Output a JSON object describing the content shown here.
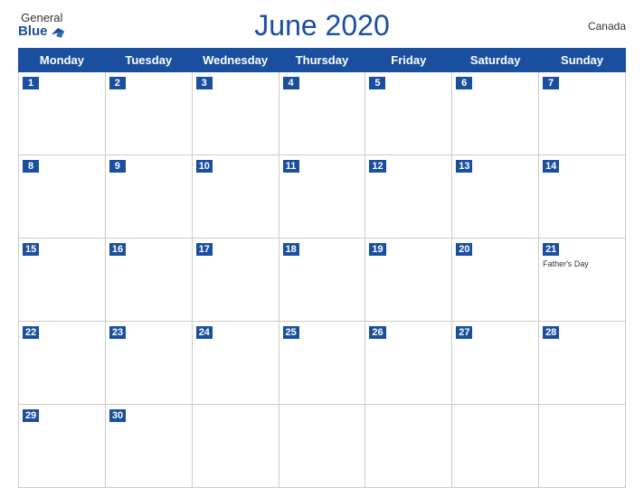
{
  "header": {
    "logo_general": "General",
    "logo_blue": "Blue",
    "title": "June 2020",
    "country": "Canada"
  },
  "days_of_week": [
    "Monday",
    "Tuesday",
    "Wednesday",
    "Thursday",
    "Friday",
    "Saturday",
    "Sunday"
  ],
  "weeks": [
    [
      {
        "day": 1,
        "holiday": ""
      },
      {
        "day": 2,
        "holiday": ""
      },
      {
        "day": 3,
        "holiday": ""
      },
      {
        "day": 4,
        "holiday": ""
      },
      {
        "day": 5,
        "holiday": ""
      },
      {
        "day": 6,
        "holiday": ""
      },
      {
        "day": 7,
        "holiday": ""
      }
    ],
    [
      {
        "day": 8,
        "holiday": ""
      },
      {
        "day": 9,
        "holiday": ""
      },
      {
        "day": 10,
        "holiday": ""
      },
      {
        "day": 11,
        "holiday": ""
      },
      {
        "day": 12,
        "holiday": ""
      },
      {
        "day": 13,
        "holiday": ""
      },
      {
        "day": 14,
        "holiday": ""
      }
    ],
    [
      {
        "day": 15,
        "holiday": ""
      },
      {
        "day": 16,
        "holiday": ""
      },
      {
        "day": 17,
        "holiday": ""
      },
      {
        "day": 18,
        "holiday": ""
      },
      {
        "day": 19,
        "holiday": ""
      },
      {
        "day": 20,
        "holiday": ""
      },
      {
        "day": 21,
        "holiday": "Father's Day"
      }
    ],
    [
      {
        "day": 22,
        "holiday": ""
      },
      {
        "day": 23,
        "holiday": ""
      },
      {
        "day": 24,
        "holiday": ""
      },
      {
        "day": 25,
        "holiday": ""
      },
      {
        "day": 26,
        "holiday": ""
      },
      {
        "day": 27,
        "holiday": ""
      },
      {
        "day": 28,
        "holiday": ""
      }
    ],
    [
      {
        "day": 29,
        "holiday": ""
      },
      {
        "day": 30,
        "holiday": ""
      },
      {
        "day": null,
        "holiday": ""
      },
      {
        "day": null,
        "holiday": ""
      },
      {
        "day": null,
        "holiday": ""
      },
      {
        "day": null,
        "holiday": ""
      },
      {
        "day": null,
        "holiday": ""
      }
    ]
  ]
}
